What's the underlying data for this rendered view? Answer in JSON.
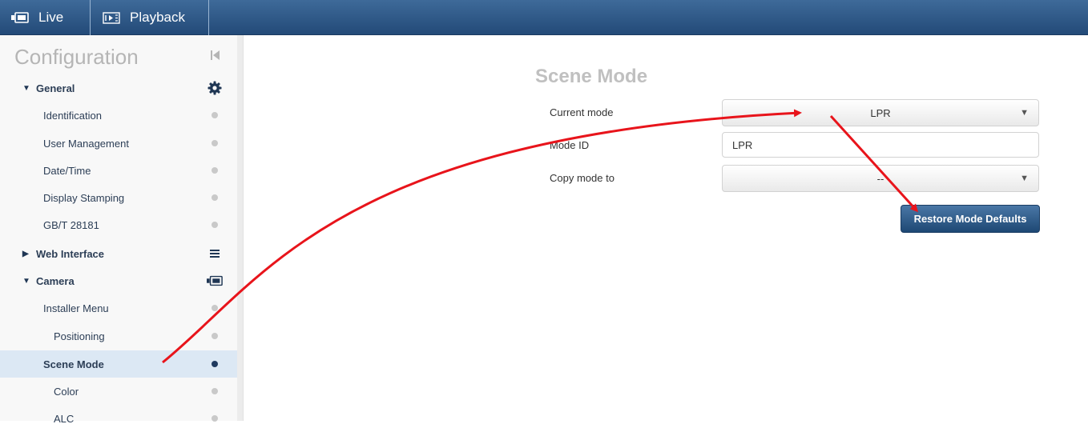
{
  "topbar": {
    "tabs": [
      {
        "label": "Live",
        "icon": "camera-icon"
      },
      {
        "label": "Playback",
        "icon": "playback-icon"
      }
    ]
  },
  "sidebar": {
    "title": "Configuration",
    "items": [
      {
        "label": "General",
        "kind": "group",
        "expanded": true,
        "icon": "gear-icon"
      },
      {
        "label": "Identification",
        "kind": "item"
      },
      {
        "label": "User Management",
        "kind": "item"
      },
      {
        "label": "Date/Time",
        "kind": "item"
      },
      {
        "label": "Display Stamping",
        "kind": "item"
      },
      {
        "label": "GB/T 28181",
        "kind": "item"
      },
      {
        "label": "Web Interface",
        "kind": "group",
        "expanded": false,
        "icon": "menu-lines-icon"
      },
      {
        "label": "Camera",
        "kind": "group",
        "expanded": true,
        "icon": "camera-icon"
      },
      {
        "label": "Installer Menu",
        "kind": "item"
      },
      {
        "label": "Positioning",
        "kind": "subitem"
      },
      {
        "label": "Scene Mode",
        "kind": "item",
        "active": true
      },
      {
        "label": "Color",
        "kind": "subitem"
      },
      {
        "label": "ALC",
        "kind": "subitem"
      }
    ]
  },
  "main": {
    "title": "Scene Mode",
    "current_mode_label": "Current mode",
    "current_mode_value": "LPR",
    "mode_id_label": "Mode ID",
    "mode_id_value": "LPR",
    "copy_mode_label": "Copy mode to",
    "copy_mode_value": "--",
    "restore_button": "Restore Mode Defaults"
  },
  "colors": {
    "topbar": "#2d5686",
    "accent_button": "#2a5583",
    "annotation_arrow": "#e8141b"
  }
}
